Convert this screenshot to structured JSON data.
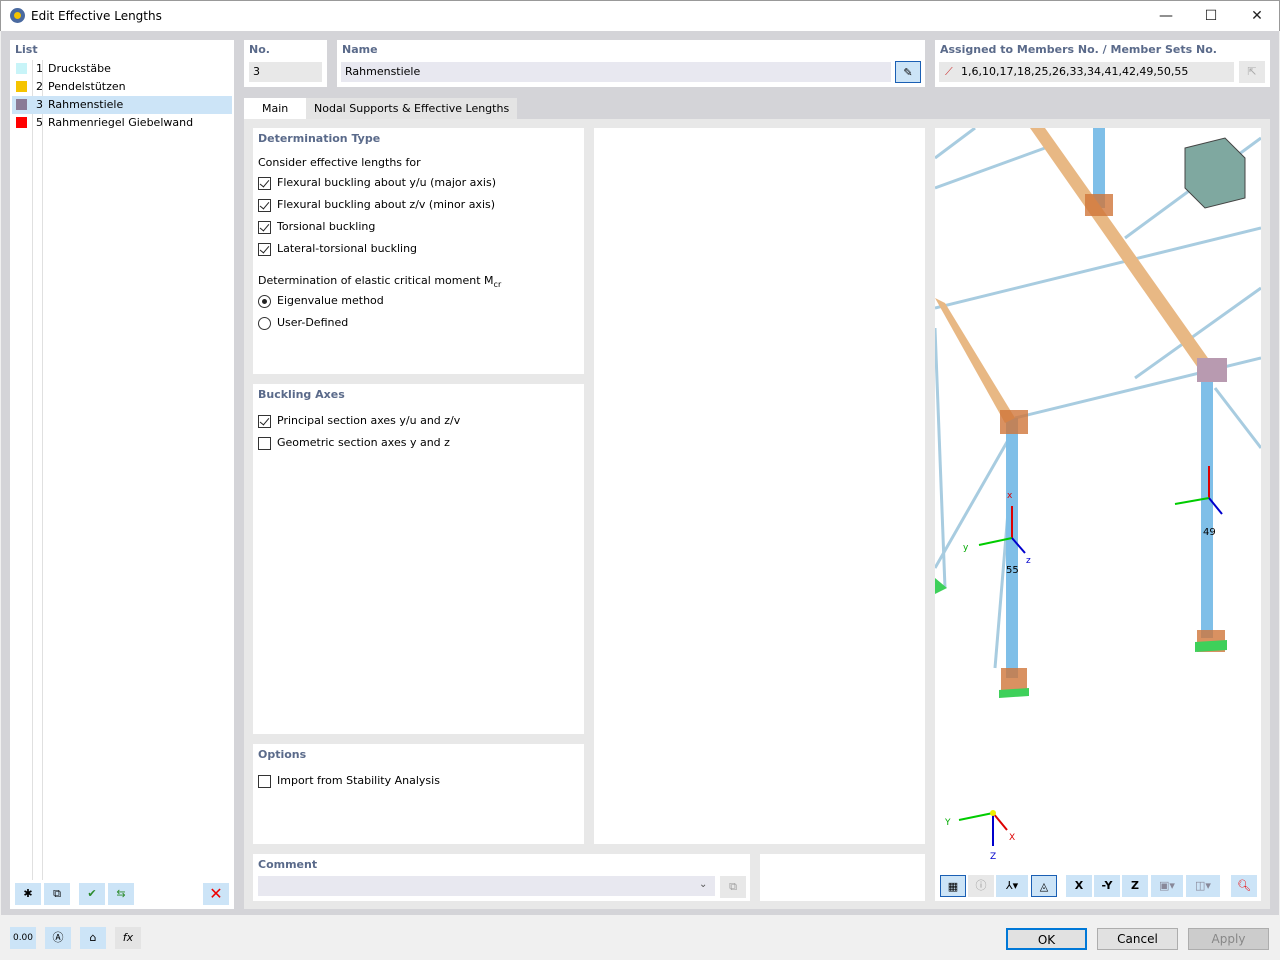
{
  "window": {
    "title": "Edit Effective Lengths",
    "minimize": "—",
    "maximize": "☐",
    "close": "✕"
  },
  "list": {
    "header": "List",
    "items": [
      {
        "no": "1",
        "name": "Druckstäbe",
        "color": "#c8f4f8"
      },
      {
        "no": "2",
        "name": "Pendelstützen",
        "color": "#f5c400"
      },
      {
        "no": "3",
        "name": "Rahmenstiele",
        "color": "#8a7a96",
        "selected": true
      },
      {
        "no": "5",
        "name": "Rahmenriegel Giebelwand",
        "color": "#ff0000"
      }
    ]
  },
  "no": {
    "label": "No.",
    "value": "3"
  },
  "name": {
    "label": "Name",
    "value": "Rahmenstiele"
  },
  "assigned": {
    "label": "Assigned to Members No. / Member Sets No.",
    "value": "1,6,10,17,18,25,26,33,34,41,42,49,50,55"
  },
  "tabs": [
    {
      "label": "Main",
      "active": true
    },
    {
      "label": "Nodal Supports & Effective Lengths"
    }
  ],
  "determination": {
    "title": "Determination Type",
    "consider_label": "Consider effective lengths for",
    "checks": [
      {
        "label": "Flexural buckling about y/u (major axis)",
        "checked": true
      },
      {
        "label": "Flexural buckling about z/v (minor axis)",
        "checked": true
      },
      {
        "label": "Torsional buckling",
        "checked": true
      },
      {
        "label": "Lateral-torsional buckling",
        "checked": true
      }
    ],
    "mcr_label": "Determination of elastic critical moment M",
    "mcr_sub": "cr",
    "radios": [
      {
        "label": "Eigenvalue method",
        "selected": true
      },
      {
        "label": "User-Defined",
        "selected": false
      }
    ]
  },
  "buckling_axes": {
    "title": "Buckling Axes",
    "checks": [
      {
        "label": "Principal section axes y/u and z/v",
        "checked": true
      },
      {
        "label": "Geometric section axes y and z",
        "checked": false
      }
    ]
  },
  "options": {
    "title": "Options",
    "checks": [
      {
        "label": "Import from Stability Analysis",
        "checked": false
      }
    ]
  },
  "comment": {
    "label": "Comment",
    "value": ""
  },
  "view": {
    "member_labels": [
      "55",
      "49"
    ],
    "axes": {
      "x": "x",
      "y": "y",
      "z": "z",
      "X": "X",
      "Y": "Y",
      "Z": "Z"
    },
    "toolbar": {
      "x": "X",
      "-y": "-Y",
      "z": "Z"
    }
  },
  "buttons": {
    "ok": "OK",
    "cancel": "Cancel",
    "apply": "Apply"
  },
  "bottom_tools": {
    "units": "0.00",
    "fx": "fx"
  }
}
